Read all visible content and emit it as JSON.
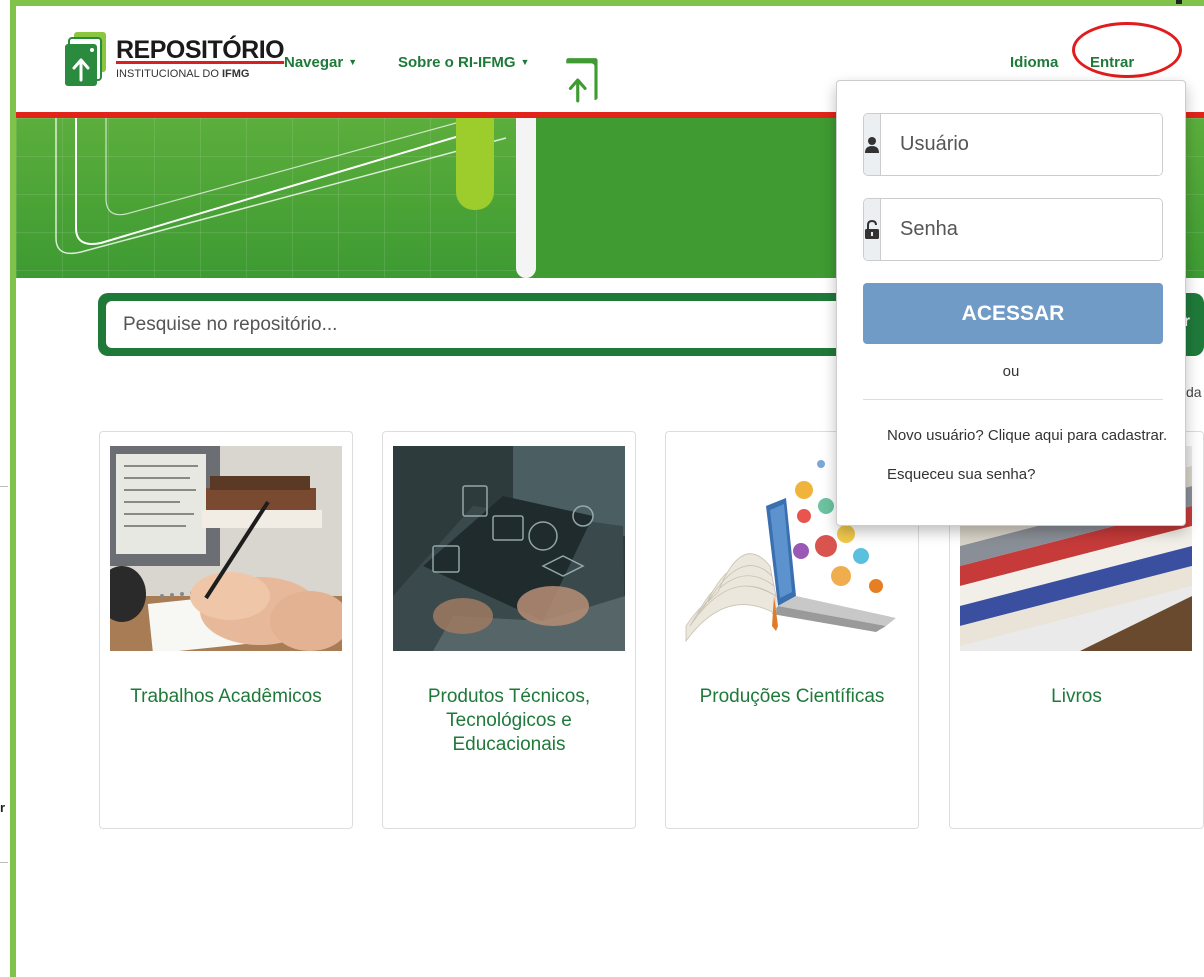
{
  "header": {
    "logo_title": "REPOSITÓRIO",
    "logo_subtitle_plain": "INSTITUCIONAL DO ",
    "logo_subtitle_bold": "IFMG",
    "nav": {
      "browse": "Navegar",
      "about": "Sobre o RI-IFMG",
      "language": "Idioma",
      "login": "Entrar"
    }
  },
  "banner": {
    "title": "REPOSITÓRIO",
    "subtitle_plain": "INSTITUCIONAL DO ",
    "subtitle_bold": "IFMG"
  },
  "search": {
    "placeholder": "Pesquise no repositório...",
    "button_partial": "r",
    "advanced_partial": "da"
  },
  "cards": [
    {
      "label": "Trabalhos Acadêmicos"
    },
    {
      "label": "Produtos Técnicos, Tecnológicos e Educacionais"
    },
    {
      "label": "Produções Científicas"
    },
    {
      "label": "Livros"
    }
  ],
  "login_dropdown": {
    "username_placeholder": "Usuário",
    "password_placeholder": "Senha",
    "submit_label": "ACESSAR",
    "or_label": "ou",
    "register_link": "Novo usuário? Clique aqui para cadastrar.",
    "forgot_link": "Esqueceu sua senha?"
  },
  "edge_text": "r",
  "colors": {
    "brand_green": "#1f7a3a",
    "banner_green": "#4ea63a",
    "accent_red": "#e2231a",
    "button_blue": "#6f9bc6",
    "frame_green": "#7fc34a"
  }
}
